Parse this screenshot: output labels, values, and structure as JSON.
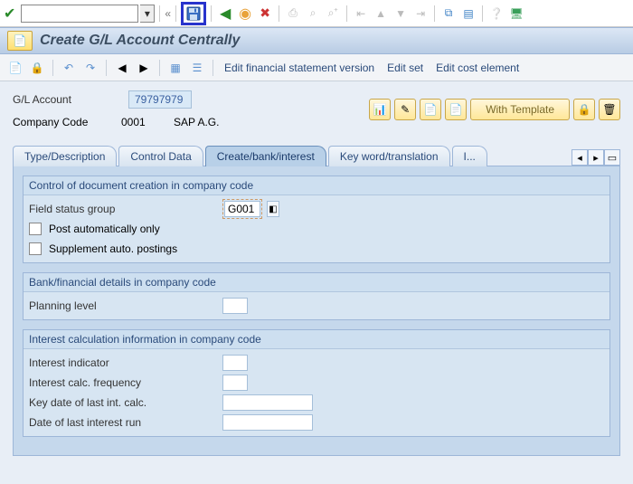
{
  "title": "Create G/L Account Centrally",
  "menu2": {
    "edit_fsv": "Edit financial statement version",
    "edit_set": "Edit set",
    "edit_cost": "Edit cost element"
  },
  "header": {
    "gl_label": "G/L Account",
    "gl_value": "79797979",
    "cc_label": "Company Code",
    "cc_value": "0001",
    "cc_name": "SAP A.G.",
    "with_template": "With Template"
  },
  "tabs": {
    "t1": "Type/Description",
    "t2": "Control Data",
    "t3": "Create/bank/interest",
    "t4": "Key word/translation",
    "t5": "I..."
  },
  "group1": {
    "title": "Control of document creation in company code",
    "fsg_label": "Field status group",
    "fsg_value": "G001",
    "post_auto": "Post automatically only",
    "supp_auto": "Supplement auto. postings"
  },
  "group2": {
    "title": "Bank/financial details in company code",
    "planning_label": "Planning level"
  },
  "group3": {
    "title": "Interest calculation information in company code",
    "ind_label": "Interest indicator",
    "freq_label": "Interest calc. frequency",
    "keydate_label": "Key date of last int. calc.",
    "lastrun_label": "Date of last interest run"
  }
}
